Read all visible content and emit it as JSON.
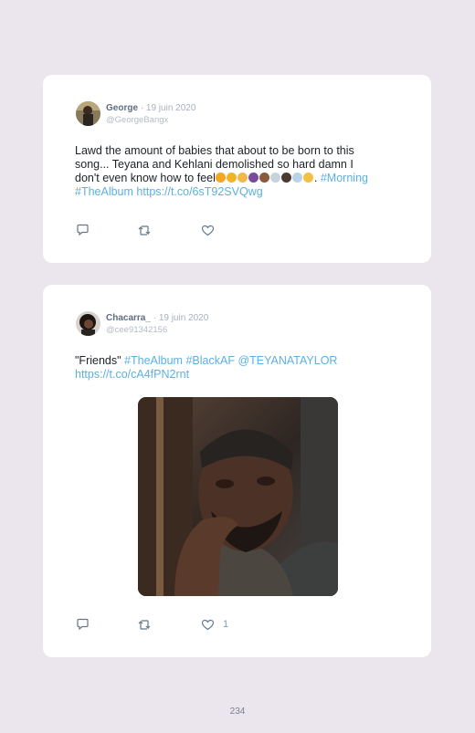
{
  "tweets": [
    {
      "display_name": "George",
      "date": "19 juin 2020",
      "handle": "@GeorgeBangx",
      "text_lines": [
        "Lawd the amount of babies that about to be born to this",
        "song... Teyana and Kehlani demolished so hard damn I",
        "don't even know how to feel"
      ],
      "after_emoji": ".",
      "hashtag_1": "#Morning",
      "hashtag_2": "#TheAlbum",
      "link": "https://t.co/6sT92SVQwg",
      "emoji_colors": [
        "#f5a623",
        "#f0b429",
        "#f2b84b",
        "#7a4a9e",
        "#8a5a3c",
        "#c7d3dc",
        "#4a3a32",
        "#b9d2e6",
        "#f4c040"
      ],
      "actions": {
        "reply_icon": "reply-icon",
        "retweet_icon": "retweet-icon",
        "like_icon": "heart-icon"
      }
    },
    {
      "display_name": "Chacarra_",
      "date": "19 juin 2020",
      "handle": "@cee91342156",
      "quote": "\"Friends\"",
      "hashtag_1": "#TheAlbum",
      "hashtag_2": "#BlackAF",
      "mention": "@TEYANATAYLOR",
      "link": "https://t.co/cA4fPN2rnt",
      "like_count": "1",
      "actions": {
        "reply_icon": "reply-icon",
        "retweet_icon": "retweet-icon",
        "like_icon": "heart-icon"
      }
    }
  ],
  "page_number": "234",
  "colors": {
    "background": "#ebe6ee",
    "link": "#5cb0e2",
    "card": "#ffffff"
  }
}
